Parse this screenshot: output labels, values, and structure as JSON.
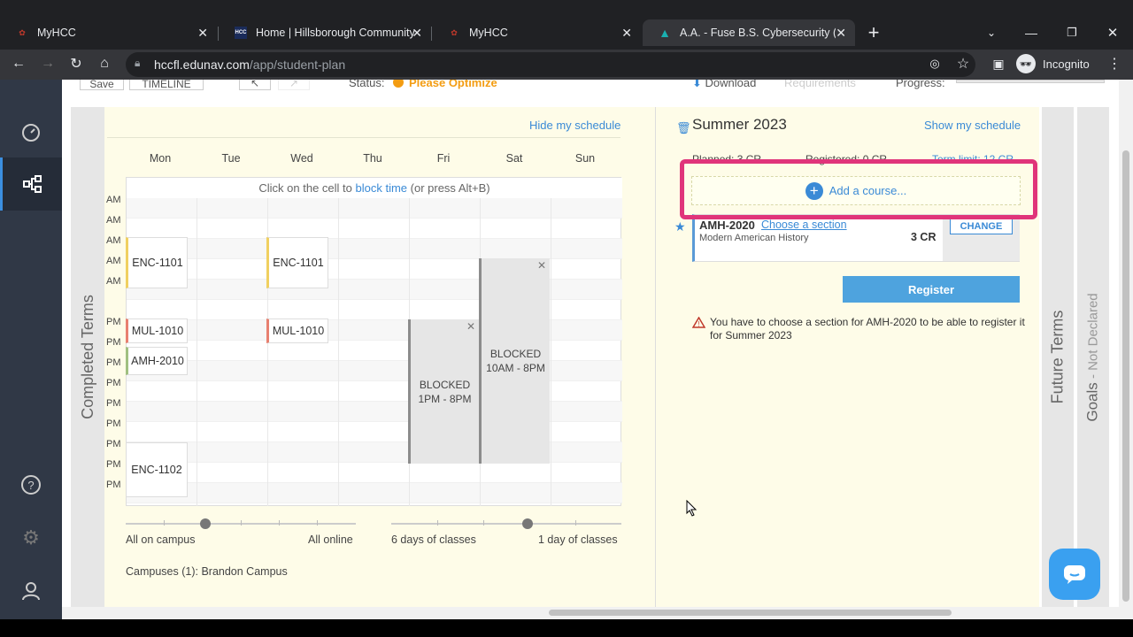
{
  "browser": {
    "tabs": [
      {
        "title": "MyHCC"
      },
      {
        "title": "Home | Hillsborough Community"
      },
      {
        "title": "MyHCC"
      },
      {
        "title": "A.A. - Fuse B.S. Cybersecurity (AA"
      }
    ],
    "url_host": "hccfl.edunav.com",
    "url_path": "/app/student-plan",
    "incognito_label": "Incognito"
  },
  "toolbar": {
    "save": "Save",
    "timeline": "TIMELINE",
    "status_label": "Status:",
    "status_value": "Please Optimize",
    "download": "Download",
    "requirements": "Requirements",
    "progress": "Progress:"
  },
  "sidebars": {
    "completed": "Completed Terms",
    "future": "Future Terms",
    "goals": "Goals",
    "goals_status": " - Not Declared"
  },
  "schedule": {
    "hide_link": "Hide my schedule",
    "days": [
      "Mon",
      "Tue",
      "Wed",
      "Thu",
      "Fri",
      "Sat",
      "Sun"
    ],
    "hint_prefix": "Click on the cell to ",
    "hint_link": "block time",
    "hint_suffix": " (or press Alt+B)",
    "time_labels": [
      "AM",
      "AM",
      "AM",
      "AM",
      "AM",
      "PM",
      "PM",
      "PM",
      "PM",
      "PM",
      "PM",
      "PM",
      "PM",
      "PM"
    ],
    "courses": {
      "enc1101_mon": "ENC-1101",
      "enc1101_wed": "ENC-1101",
      "mul1010_mon": "MUL-1010",
      "mul1010_wed": "MUL-1010",
      "amh2010_mon": "AMH-2010",
      "enc1102_mon": "ENC-1102"
    },
    "blocked_fri": {
      "label": "BLOCKED",
      "time": "1PM - 8PM"
    },
    "blocked_sat": {
      "label": "BLOCKED",
      "time": "10AM - 8PM"
    },
    "slider1": {
      "left": "All on campus",
      "right": "All online"
    },
    "slider2": {
      "left": "6 days of classes",
      "right": "1 day of classes"
    },
    "campuses": "Campuses (1): Brandon Campus"
  },
  "term": {
    "title": "Summer 2023",
    "show_link": "Show my schedule",
    "planned": "Planned: 3 CR",
    "registered": "Registered: 0 CR",
    "term_limit": "Term limit: 12 CR",
    "add_course": "Add a course...",
    "course_code": "AMH-2020",
    "choose_section": "Choose a section",
    "course_name": "Modern American History",
    "course_credits": "3 CR",
    "change": "CHANGE",
    "register": "Register",
    "warning": "You have to choose a section for AMH-2020 to be able to register it for Summer 2023"
  },
  "colors": {
    "accent": "#3a8ad6",
    "highlight": "#e0347a",
    "status": "#f39c12",
    "plan_bg": "#fefce8"
  }
}
